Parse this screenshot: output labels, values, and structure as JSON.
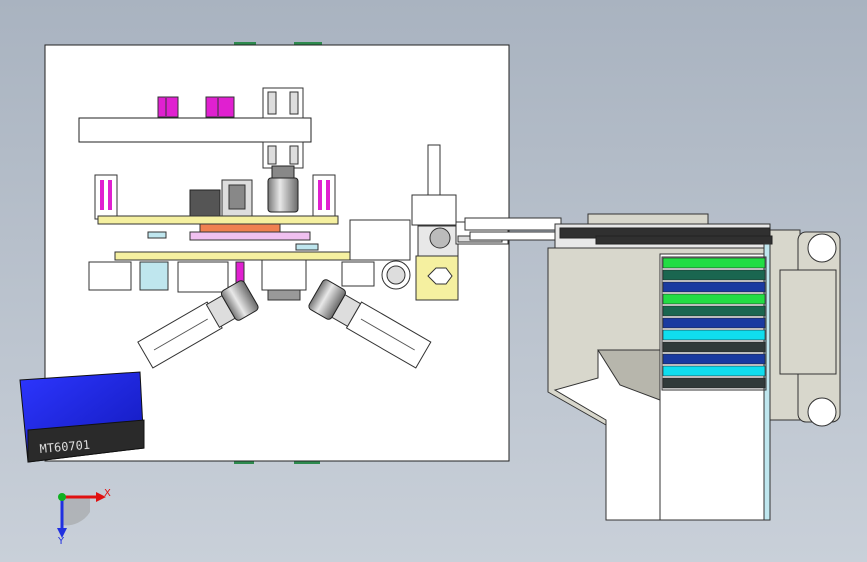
{
  "viewport": {
    "background_top": "#a9b3c0",
    "background_bottom": "#c9d0d9"
  },
  "plate": {
    "label": "MT60701",
    "box_color": "#1a22e6"
  },
  "axes": {
    "x_label": "X",
    "y_label": "Y",
    "x_color": "#e01010",
    "y_color": "#2030e0",
    "z_color": "#10b020"
  },
  "colors": {
    "magenta": "#e020d0",
    "yellow": "#f5f0a0",
    "panel": "#ffffff",
    "steel": "#b8b8b8",
    "dark": "#303030",
    "magazine_gray": "#d8d7cc",
    "magazine_shadow": "#b7b6ac",
    "light_blue": "#bfe6ee"
  },
  "magazine": {
    "layers": [
      {
        "color": "#22dd44"
      },
      {
        "color": "#1a6650"
      },
      {
        "color": "#1a3aa0"
      },
      {
        "color": "#22dd44"
      },
      {
        "color": "#1a6650"
      },
      {
        "color": "#1a3aa0"
      },
      {
        "color": "#10ddee"
      },
      {
        "color": "#303a3a"
      },
      {
        "color": "#1a3aa0"
      },
      {
        "color": "#10ddee"
      },
      {
        "color": "#303a3a"
      }
    ]
  }
}
